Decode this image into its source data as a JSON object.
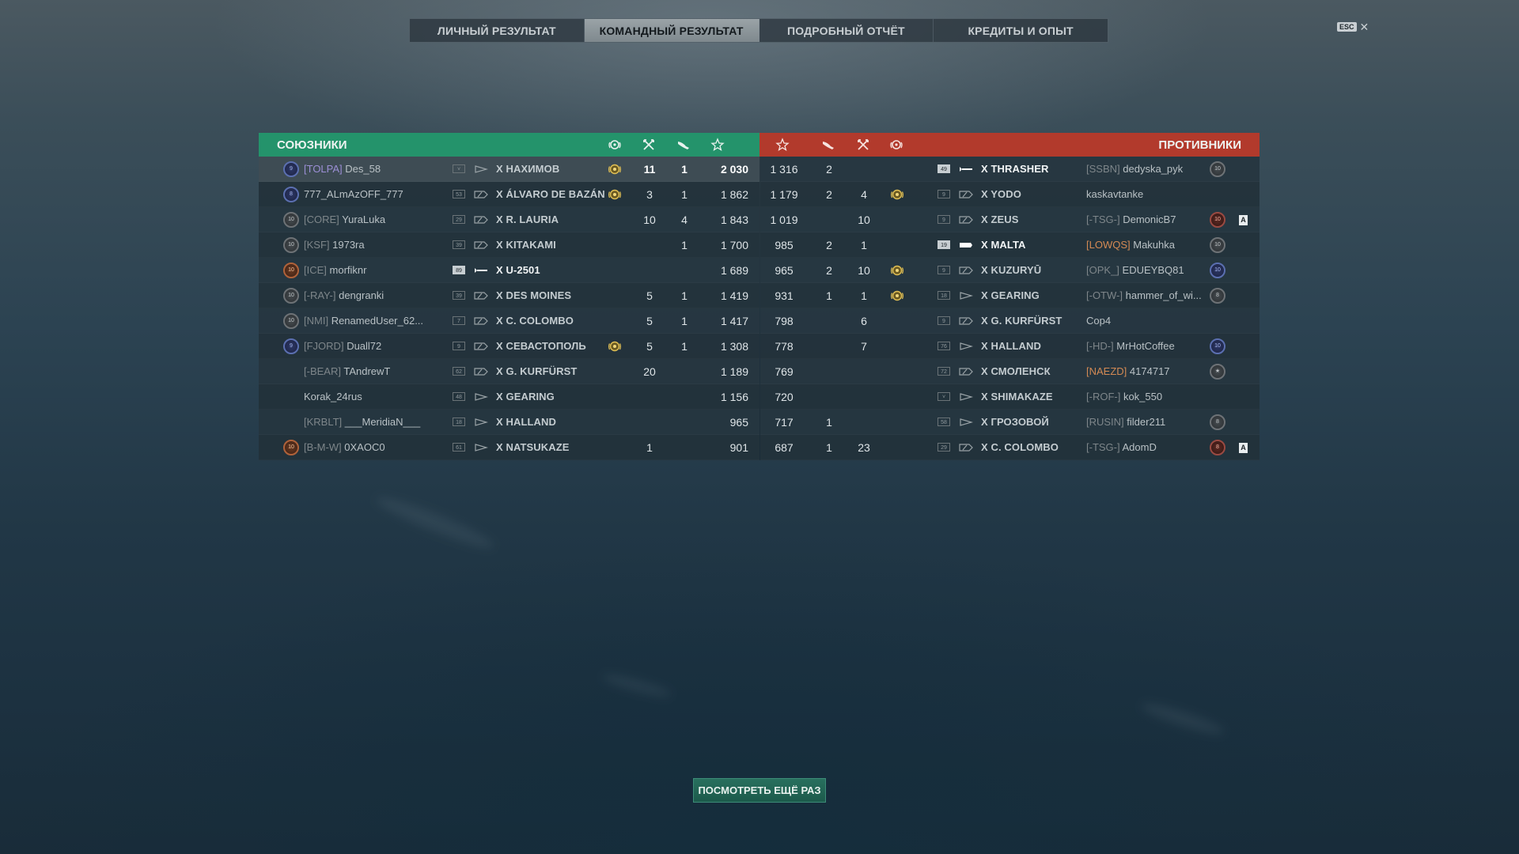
{
  "tabs": [
    "ЛИЧНЫЙ РЕЗУЛЬТАТ",
    "КОМАНДНЫЙ РЕЗУЛЬТАТ",
    "ПОДРОБНЫЙ ОТЧЁТ",
    "КРЕДИТЫ И ОПЫТ"
  ],
  "active_tab": 1,
  "esc": {
    "key": "ESC",
    "close": "✕"
  },
  "allies": {
    "title": "СОЮЗНИКИ",
    "rows": [
      {
        "badge": "9",
        "badge_color": "blue",
        "clan": "[TOLPA]",
        "clan_color": "violet",
        "name": "Des_58",
        "level": "",
        "level_hl": false,
        "ship_icon": "destroyer",
        "ship": "X НАХИМОВ",
        "medal": true,
        "kills": "11",
        "caps": "1",
        "score": "2 030",
        "highlight": true,
        "bright": false
      },
      {
        "badge": "8",
        "badge_color": "blue",
        "clan": "",
        "clan_color": "",
        "name": "777_ALmAzOFF_777",
        "level": "53",
        "level_hl": false,
        "ship_icon": "cruiser",
        "ship": "X ÁLVARO DE BAZÁN",
        "medal": true,
        "kills": "3",
        "caps": "1",
        "score": "1 862",
        "highlight": false,
        "bright": false
      },
      {
        "badge": "10",
        "badge_color": "grey",
        "clan": "[CORE]",
        "clan_color": "",
        "name": "YuraLuka",
        "level": "29",
        "level_hl": false,
        "ship_icon": "battleship",
        "ship": "X R. LAURIA",
        "medal": false,
        "kills": "10",
        "caps": "4",
        "score": "1 843",
        "highlight": false,
        "bright": false
      },
      {
        "badge": "10",
        "badge_color": "grey",
        "clan": "[KSF]",
        "clan_color": "",
        "name": "1973ra",
        "level": "39",
        "level_hl": false,
        "ship_icon": "battleship",
        "ship": "X KITAKAMI",
        "medal": false,
        "kills": "",
        "caps": "1",
        "score": "1 700",
        "highlight": false,
        "bright": false
      },
      {
        "badge": "10",
        "badge_color": "orange",
        "clan": "[ICE]",
        "clan_color": "",
        "name": "morfiknr",
        "level": "89",
        "level_hl": true,
        "ship_icon": "submarine",
        "ship": "X U-2501",
        "medal": false,
        "kills": "",
        "caps": "",
        "score": "1 689",
        "highlight": false,
        "bright": true
      },
      {
        "badge": "10",
        "badge_color": "grey",
        "clan": "[-RAY-]",
        "clan_color": "",
        "name": "dengranki",
        "level": "39",
        "level_hl": false,
        "ship_icon": "battleship",
        "ship": "X DES MOINES",
        "medal": false,
        "kills": "5",
        "caps": "1",
        "score": "1 419",
        "highlight": false,
        "bright": false
      },
      {
        "badge": "10",
        "badge_color": "grey",
        "clan": "[NMI]",
        "clan_color": "",
        "name": "RenamedUser_62...",
        "level": "7",
        "level_hl": false,
        "ship_icon": "battleship",
        "ship": "X C. COLOMBO",
        "medal": false,
        "kills": "5",
        "caps": "1",
        "score": "1 417",
        "highlight": false,
        "bright": false
      },
      {
        "badge": "9",
        "badge_color": "blue",
        "clan": "[FJORD]",
        "clan_color": "",
        "name": "Duall72",
        "level": "9",
        "level_hl": false,
        "ship_icon": "battleship",
        "ship": "X СЕВАСТОПОЛЬ",
        "medal": true,
        "kills": "5",
        "caps": "1",
        "score": "1 308",
        "highlight": false,
        "bright": false
      },
      {
        "badge": "",
        "badge_color": "",
        "clan": "[-BEAR]",
        "clan_color": "",
        "name": "TAndrewT",
        "level": "62",
        "level_hl": false,
        "ship_icon": "battleship",
        "ship": "X G. KURFÜRST",
        "medal": false,
        "kills": "20",
        "caps": "",
        "score": "1 189",
        "highlight": false,
        "bright": false
      },
      {
        "badge": "",
        "badge_color": "",
        "clan": "",
        "clan_color": "",
        "name": "Korak_24rus",
        "level": "48",
        "level_hl": false,
        "ship_icon": "destroyer",
        "ship": "X GEARING",
        "medal": false,
        "kills": "",
        "caps": "",
        "score": "1 156",
        "highlight": false,
        "bright": false
      },
      {
        "badge": "",
        "badge_color": "",
        "clan": "[KRBLT]",
        "clan_color": "",
        "name": "___MeridiaN___",
        "level": "18",
        "level_hl": false,
        "ship_icon": "destroyer",
        "ship": "X HALLAND",
        "medal": false,
        "kills": "",
        "caps": "",
        "score": "965",
        "highlight": false,
        "bright": false
      },
      {
        "badge": "10",
        "badge_color": "orange",
        "clan": "[B-M-W]",
        "clan_color": "",
        "name": "0XAOC0",
        "level": "61",
        "level_hl": false,
        "ship_icon": "destroyer",
        "ship": "X NATSUKAZE",
        "medal": false,
        "kills": "1",
        "caps": "",
        "score": "901",
        "highlight": false,
        "bright": false
      }
    ]
  },
  "enemies": {
    "title": "ПРОТИВНИКИ",
    "rows": [
      {
        "score": "1 316",
        "caps": "2",
        "kills": "",
        "medal": false,
        "level": "49",
        "level_hl": true,
        "ship_icon": "submarine",
        "ship": "X THRASHER",
        "bright": true,
        "clan": "[SSBN]",
        "clan_color": "",
        "name": "dedyska_pyk",
        "badge": "10",
        "badge_color": "grey",
        "flag": ""
      },
      {
        "score": "1 179",
        "caps": "2",
        "kills": "4",
        "medal": true,
        "level": "9",
        "level_hl": false,
        "ship_icon": "battleship",
        "ship": "X YODO",
        "bright": false,
        "clan": "",
        "clan_color": "",
        "name": "kaskavtanke",
        "badge": "",
        "badge_color": "",
        "flag": ""
      },
      {
        "score": "1 019",
        "caps": "",
        "kills": "10",
        "medal": false,
        "level": "9",
        "level_hl": false,
        "ship_icon": "battleship",
        "ship": "X ZEUS",
        "bright": false,
        "clan": "[-TSG-]",
        "clan_color": "",
        "name": "DemonicB7",
        "badge": "10",
        "badge_color": "red",
        "flag": "A"
      },
      {
        "score": "985",
        "caps": "2",
        "kills": "1",
        "medal": false,
        "level": "19",
        "level_hl": true,
        "ship_icon": "carrier",
        "ship": "X MALTA",
        "bright": true,
        "clan": "[LOWQS]",
        "clan_color": "orange",
        "name": "Makuhka",
        "badge": "10",
        "badge_color": "grey",
        "flag": ""
      },
      {
        "score": "965",
        "caps": "2",
        "kills": "10",
        "medal": true,
        "level": "9",
        "level_hl": false,
        "ship_icon": "battleship",
        "ship": "X KUZURYŪ",
        "bright": false,
        "clan": "[OPK_]",
        "clan_color": "",
        "name": "EDUEYBQ81",
        "badge": "10",
        "badge_color": "blue",
        "flag": ""
      },
      {
        "score": "931",
        "caps": "1",
        "kills": "1",
        "medal": true,
        "level": "18",
        "level_hl": false,
        "ship_icon": "destroyer",
        "ship": "X GEARING",
        "bright": false,
        "clan": "[-OTW-]",
        "clan_color": "",
        "name": "hammer_of_wi...",
        "badge": "8",
        "badge_color": "grey",
        "flag": ""
      },
      {
        "score": "798",
        "caps": "",
        "kills": "6",
        "medal": false,
        "level": "9",
        "level_hl": false,
        "ship_icon": "battleship",
        "ship": "X G. KURFÜRST",
        "bright": false,
        "clan": "",
        "clan_color": "",
        "name": "Cop4",
        "badge": "",
        "badge_color": "",
        "flag": ""
      },
      {
        "score": "778",
        "caps": "",
        "kills": "7",
        "medal": false,
        "level": "76",
        "level_hl": false,
        "ship_icon": "destroyer",
        "ship": "X HALLAND",
        "bright": false,
        "clan": "[-HD-]",
        "clan_color": "",
        "name": "MrHotCoffee",
        "badge": "10",
        "badge_color": "blue",
        "flag": ""
      },
      {
        "score": "769",
        "caps": "",
        "kills": "",
        "medal": false,
        "level": "72",
        "level_hl": false,
        "ship_icon": "battleship",
        "ship": "X СМОЛЕНСК",
        "bright": false,
        "clan": "[NAEZD]",
        "clan_color": "orange",
        "name": "4174717",
        "badge": "★",
        "badge_color": "grey",
        "flag": ""
      },
      {
        "score": "720",
        "caps": "",
        "kills": "",
        "medal": false,
        "level": "",
        "level_hl": false,
        "ship_icon": "destroyer",
        "ship": "X SHIMAKAZE",
        "bright": false,
        "clan": "[-ROF-]",
        "clan_color": "",
        "name": "kok_550",
        "badge": "",
        "badge_color": "",
        "flag": ""
      },
      {
        "score": "717",
        "caps": "1",
        "kills": "",
        "medal": false,
        "level": "58",
        "level_hl": false,
        "ship_icon": "destroyer",
        "ship": "X ГРОЗОВОЙ",
        "bright": false,
        "clan": "[RUSIN]",
        "clan_color": "",
        "name": "filder211",
        "badge": "8",
        "badge_color": "grey",
        "flag": ""
      },
      {
        "score": "687",
        "caps": "1",
        "kills": "23",
        "medal": false,
        "level": "29",
        "level_hl": false,
        "ship_icon": "battleship",
        "ship": "X C. COLOMBO",
        "bright": false,
        "clan": "[-TSG-]",
        "clan_color": "",
        "name": "AdomD",
        "badge": "8",
        "badge_color": "red",
        "flag": "A"
      }
    ]
  },
  "replay_button": "ПОСМОТРЕТЬ ЕЩЁ РАЗ",
  "colors": {
    "allies": "#24936b",
    "enemies": "#b23a2c",
    "accent_bg": "#213746"
  }
}
